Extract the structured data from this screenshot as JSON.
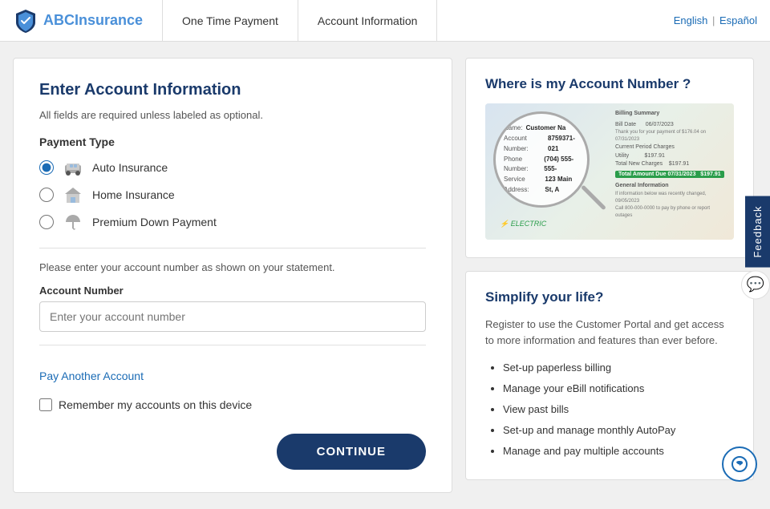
{
  "header": {
    "logo_text": "ABCInsurance",
    "logo_text_prefix": "ABC",
    "logo_text_suffix": "Insurance",
    "nav_tabs": [
      {
        "id": "one-time-payment",
        "label": "One Time Payment"
      },
      {
        "id": "account-information",
        "label": "Account Information"
      }
    ],
    "lang_english": "English",
    "lang_separator": "|",
    "lang_spanish": "Español"
  },
  "feedback": {
    "label": "Feedback"
  },
  "left_panel": {
    "title": "Enter Account Information",
    "required_note": "All fields are required unless labeled as optional.",
    "payment_type_label": "Payment Type",
    "payment_options": [
      {
        "id": "auto",
        "label": "Auto Insurance",
        "selected": true
      },
      {
        "id": "home",
        "label": "Home Insurance",
        "selected": false
      },
      {
        "id": "premium",
        "label": "Premium Down Payment",
        "selected": false
      }
    ],
    "account_note": "Please enter your account number as shown on your statement.",
    "account_number_label": "Account Number",
    "account_number_placeholder": "Enter your account number",
    "pay_another_label": "Pay Another Account",
    "remember_label": "Remember my accounts on this device",
    "continue_button": "CONTINUE"
  },
  "right_panel": {
    "where_card": {
      "title": "Where is my Account Number ?",
      "statement": {
        "name_label": "Name:",
        "name_value": "Customer Na",
        "account_label": "Account Number:",
        "account_value": "8759371-021",
        "phone_label": "Phone Number:",
        "phone_value": "(704) 555-555-",
        "address_label": "Service Address:",
        "address_value": "123 Main St, A",
        "billing_title": "Billing Summary",
        "bill_date_label": "Bill Date",
        "bill_date_value": "06/07/2023",
        "amount_label": "Total Amount Due on 07/31/2023",
        "amount_value": "$197.91",
        "logo": "ELECTRIC"
      }
    },
    "simplify_card": {
      "title": "Simplify your life?",
      "description": "Register to use the Customer Portal and get access to more information and features than ever before.",
      "list_items": [
        "Set-up paperless billing",
        "Manage your eBill notifications",
        "View past bills",
        "Set-up and manage monthly AutoPay",
        "Manage and pay multiple accounts"
      ]
    }
  }
}
